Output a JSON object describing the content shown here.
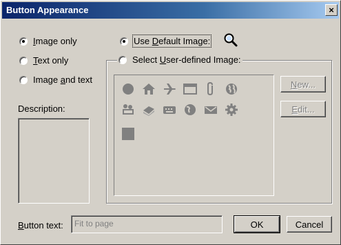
{
  "window": {
    "title": "Button Appearance",
    "close_label": "×"
  },
  "style_options": [
    {
      "pre": "",
      "accel": "I",
      "post": "mage only",
      "selected": true
    },
    {
      "pre": "",
      "accel": "T",
      "post": "ext only",
      "selected": false
    },
    {
      "pre": "Image ",
      "accel": "a",
      "post": "nd text",
      "selected": false
    }
  ],
  "image_source": {
    "default": {
      "pre": "Use ",
      "accel": "D",
      "post": "efault Image:",
      "selected": true
    },
    "user": {
      "pre": "Select ",
      "accel": "U",
      "post": "ser-defined Image:",
      "selected": false
    }
  },
  "icons": [
    "circle-icon",
    "house-icon",
    "airplane-icon",
    "window-icon",
    "paperclip-icon",
    "globe-icon",
    "people-icon",
    "book-icon",
    "keyboard-icon",
    "earth-icon",
    "envelope-icon",
    "gear-icon",
    "square-icon"
  ],
  "side_buttons": {
    "new": {
      "accel": "N",
      "post": "ew..."
    },
    "edit": {
      "accel": "E",
      "post": "dit..."
    }
  },
  "description_label": "Description:",
  "button_text": {
    "accel": "B",
    "post": "utton text:",
    "value": "Fit to page"
  },
  "ok_label": "OK",
  "cancel_label": "Cancel"
}
